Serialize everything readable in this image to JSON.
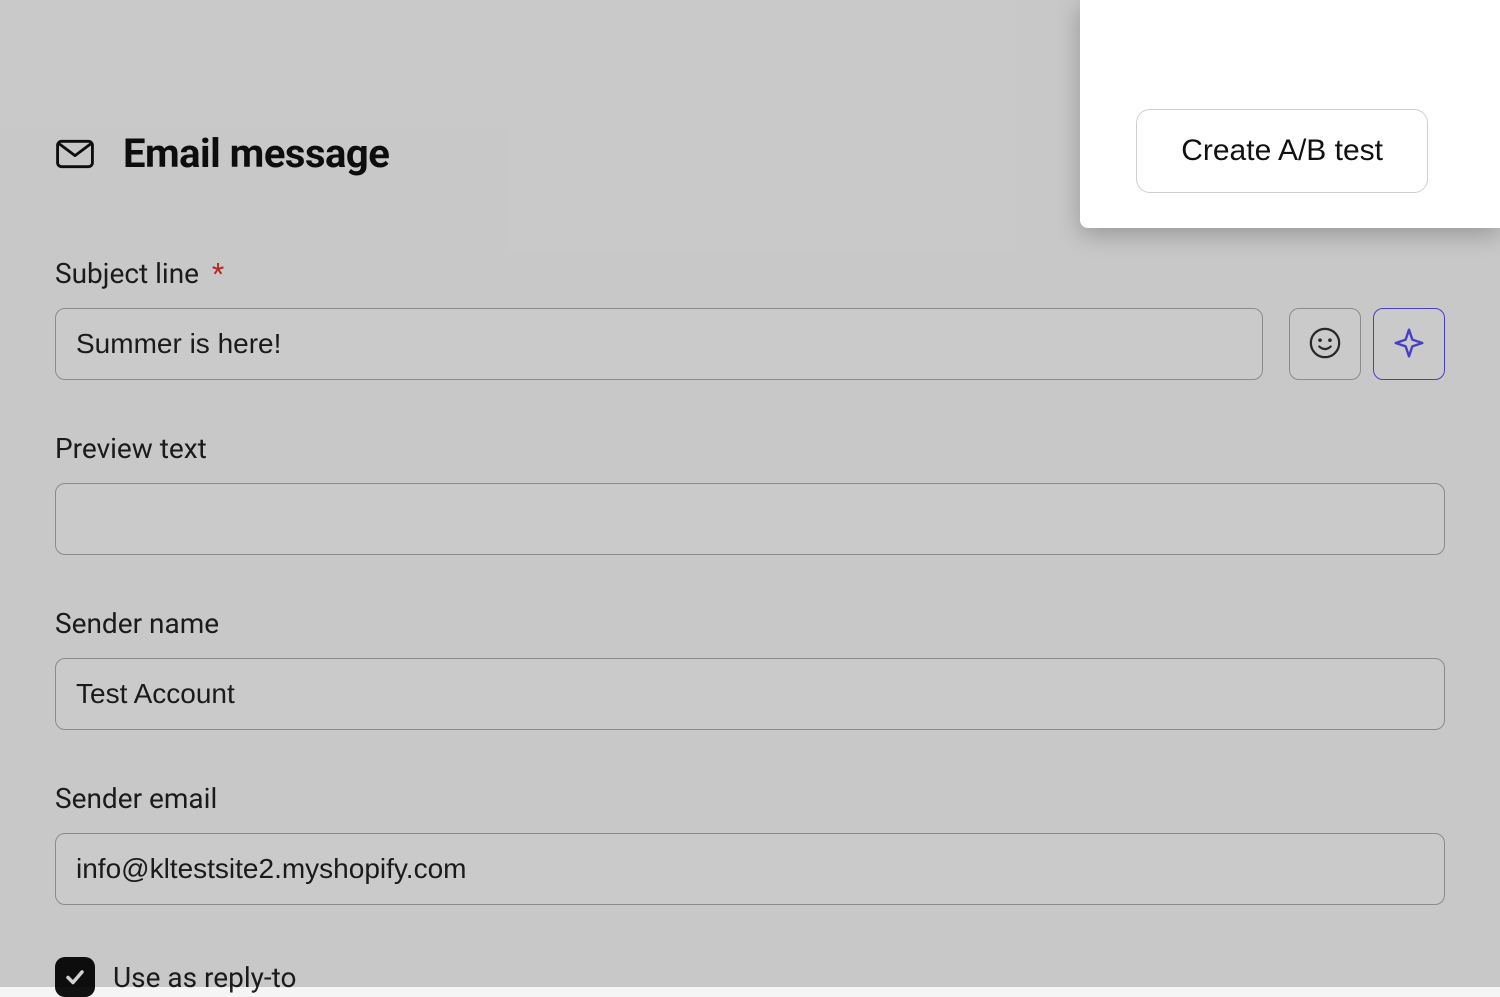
{
  "header": {
    "title": "Email message",
    "ab_button_label": "Create A/B test"
  },
  "fields": {
    "subject": {
      "label": "Subject line",
      "required_marker": "*",
      "value": "Summer is here!"
    },
    "preview": {
      "label": "Preview text",
      "value": ""
    },
    "sender_name": {
      "label": "Sender name",
      "value": "Test Account"
    },
    "sender_email": {
      "label": "Sender email",
      "value": "info@kltestsite2.myshopify.com"
    },
    "reply_to": {
      "label": "Use as reply-to",
      "checked": true
    }
  },
  "icons": {
    "mail": "mail-icon",
    "emoji": "emoji-icon",
    "ai_sparkle": "sparkle-icon"
  }
}
